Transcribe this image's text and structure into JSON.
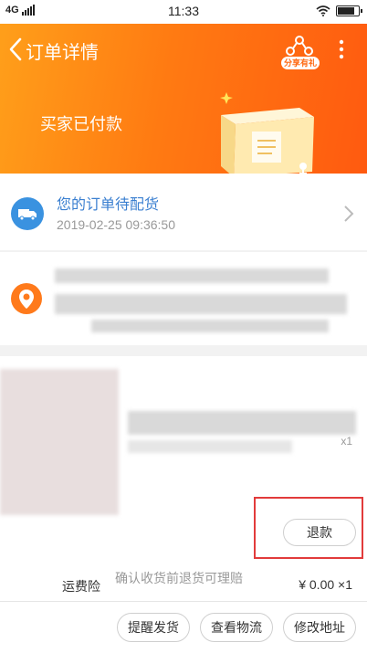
{
  "statusbar": {
    "network": "4G",
    "time": "11:33"
  },
  "header": {
    "title": "订单详情",
    "share_badge": "分享有礼",
    "status": "买家已付款"
  },
  "order": {
    "status_text": "您的订单待配货",
    "timestamp": "2019-02-25 09:36:50"
  },
  "product": {
    "quantity": "x1",
    "refund_label": "退款"
  },
  "insurance": {
    "label": "运费险",
    "description": "确认收货前退货可理赔",
    "price": "¥ 0.00 ×1"
  },
  "actions": {
    "remind_ship": "提醒发货",
    "view_logistics": "查看物流",
    "modify_address": "修改地址"
  },
  "colors": {
    "header_start": "#ff9f1a",
    "header_end": "#ff5a10",
    "status_blue": "#3a7fd0",
    "pin_orange": "#ff7a1b",
    "highlight_red": "#e23b3b"
  }
}
